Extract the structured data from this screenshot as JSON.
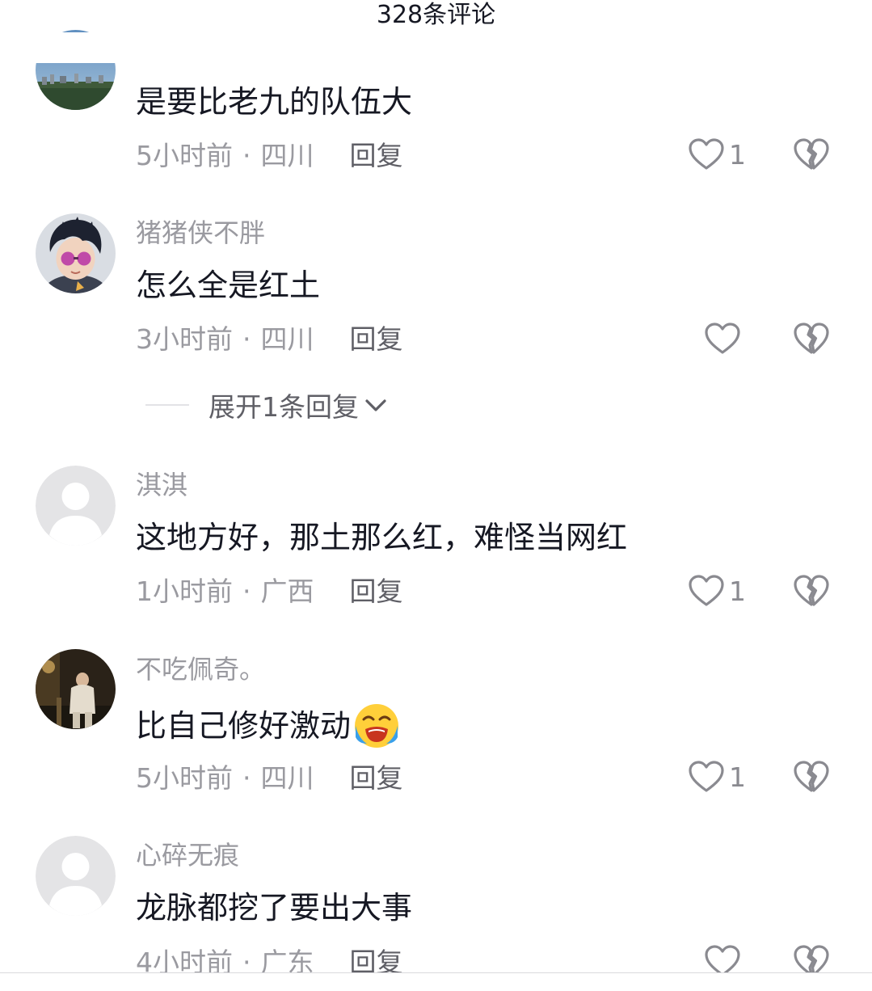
{
  "header": {
    "title": "328条评论"
  },
  "comments": [
    {
      "username": "",
      "content": "是要比老九的队伍大",
      "time": "5小时前",
      "location": "四川",
      "reply_label": "回复",
      "like_count": "1",
      "avatar": "landscape-photo"
    },
    {
      "username": "猪猪侠不胖",
      "content": "怎么全是红土",
      "time": "3小时前",
      "location": "四川",
      "reply_label": "回复",
      "like_count": "",
      "avatar": "cartoon-boy-sunglasses"
    },
    {
      "username": "淇淇",
      "content": "这地方好，那土那么红，难怪当网红",
      "time": "1小时前",
      "location": "广西",
      "reply_label": "回复",
      "like_count": "1",
      "avatar": "default-user"
    },
    {
      "username": "不吃佩奇。",
      "content": "比自己修好激动",
      "time": "5小时前",
      "location": "四川",
      "reply_label": "回复",
      "like_count": "1",
      "avatar": "night-street-photo",
      "emoji": "crying-face"
    },
    {
      "username": "心碎无痕",
      "content": "龙脉都挖了要出大事",
      "time": "4小时前",
      "location": "广东",
      "reply_label": "回复",
      "like_count": "",
      "avatar": "default-user"
    }
  ],
  "expand_replies": {
    "label": "展开1条回复"
  },
  "colors": {
    "text_primary": "#161823",
    "text_secondary": "#9a9aa0",
    "icon": "#8a8a90"
  }
}
